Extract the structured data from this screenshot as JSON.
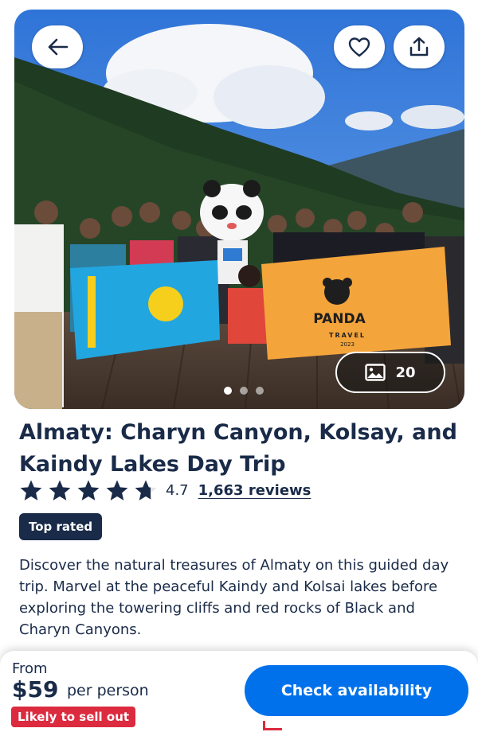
{
  "hero": {
    "photo_count": "20",
    "carousel": {
      "total": 3,
      "active": 1
    }
  },
  "icons": {
    "back": "arrow-left-icon",
    "favorite": "heart-icon",
    "share": "share-icon",
    "gallery": "image-icon",
    "star": "star-icon"
  },
  "photo_text": {
    "flag_logo": "PANDA",
    "flag_sub": "TRAVEL",
    "flag_year": "2023"
  },
  "activity": {
    "title": "Almaty: Charyn Canyon, Kolsay, and Kaindy Lakes Day Trip",
    "rating_value": "4.7",
    "rating_fraction": 0.94,
    "reviews_label": "1,663 reviews",
    "badge": "Top rated",
    "description": "Discover the natural treasures of Almaty on this guided day trip. Marvel at the peaceful Kaindy and Kolsai lakes before exploring the towering cliffs and red rocks of Black and Charyn Canyons."
  },
  "booking": {
    "from_label": "From",
    "price": "$59",
    "per_person": "per person",
    "availability_badge": "Likely to sell out",
    "cta_label": "Check availability"
  },
  "colors": {
    "primary_text": "#1a2b49",
    "cta_blue": "#0071eb",
    "alert_red": "#dc2a3f",
    "star_fill": "#1a2b49"
  }
}
